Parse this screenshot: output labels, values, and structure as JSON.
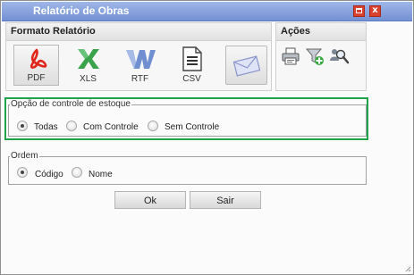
{
  "window": {
    "title": "Relatório de Obras"
  },
  "formato": {
    "header": "Formato Relatório",
    "buttons": [
      {
        "label": "PDF",
        "icon": "pdf-icon"
      },
      {
        "label": "XLS",
        "icon": "xls-icon"
      },
      {
        "label": "RTF",
        "icon": "rtf-icon"
      },
      {
        "label": "CSV",
        "icon": "csv-icon"
      },
      {
        "label": "",
        "icon": "envelope-icon"
      }
    ]
  },
  "acoes": {
    "header": "Ações",
    "icons": [
      "printer-icon",
      "filter-add-icon",
      "search-people-icon"
    ]
  },
  "estoque": {
    "legend": "Opção de controle de estoque",
    "options": [
      {
        "label": "Todas",
        "checked": true
      },
      {
        "label": "Com Controle",
        "checked": false
      },
      {
        "label": "Sem Controle",
        "checked": false
      }
    ]
  },
  "ordem": {
    "legend": "Ordem",
    "options": [
      {
        "label": "Código",
        "checked": true
      },
      {
        "label": "Nome",
        "checked": false
      }
    ]
  },
  "actions": {
    "ok_label": "Ok",
    "sair_label": "Sair"
  },
  "colors": {
    "title_bar": "#7f9bdc",
    "highlight": "#1fa34a",
    "window_button": "#d9402e"
  }
}
